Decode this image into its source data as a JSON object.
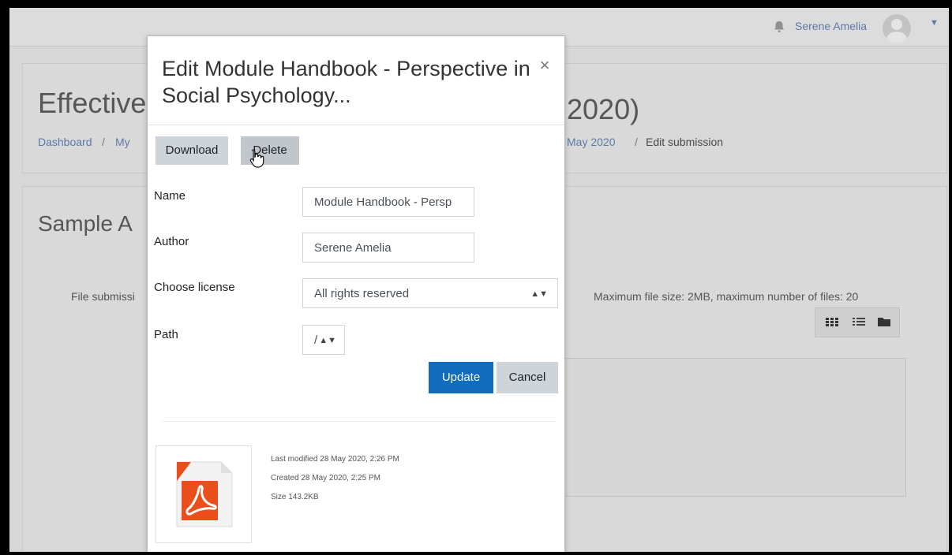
{
  "navbar": {
    "username": "Serene Amelia",
    "icons": [
      "bell-icon",
      "avatar",
      "caret-down-icon"
    ]
  },
  "header": {
    "title_left": "Effective",
    "title_right": "2020)",
    "breadcrumb": {
      "dashboard": "Dashboard",
      "sep": "/",
      "my": "My",
      "date_fragment": "May 2020",
      "current": "Edit submission"
    }
  },
  "main": {
    "section_title": "Sample A",
    "file_submissions_label": "File submissi",
    "max_size_text": "Maximum file size: 2MB, maximum number of files: 20",
    "view_icons": [
      "grid-view-icon",
      "list-view-icon",
      "folder-view-icon"
    ]
  },
  "modal": {
    "title": "Edit Module Handbook - Perspective in Social Psychology...",
    "close_glyph": "×",
    "download_label": "Download",
    "delete_label": "Delete",
    "name_label": "Name",
    "name_value": "Module Handbook - Persp",
    "author_label": "Author",
    "author_value": "Serene Amelia",
    "license_label": "Choose license",
    "license_value": "All rights reserved",
    "path_label": "Path",
    "path_value": "/",
    "update_label": "Update",
    "cancel_label": "Cancel",
    "file_icon": "pdf-file-icon",
    "last_modified": "Last modified  28 May 2020, 2:26 PM",
    "created": "Created  28 May 2020, 2:25 PM",
    "size": "Size  143.2KB"
  },
  "colors": {
    "primary": "#0f6cbf",
    "link": "#5b7aa6",
    "button_grey": "#ced4da",
    "pdf_red": "#e94e1b",
    "overlay_bg": "#d7d7d7"
  }
}
